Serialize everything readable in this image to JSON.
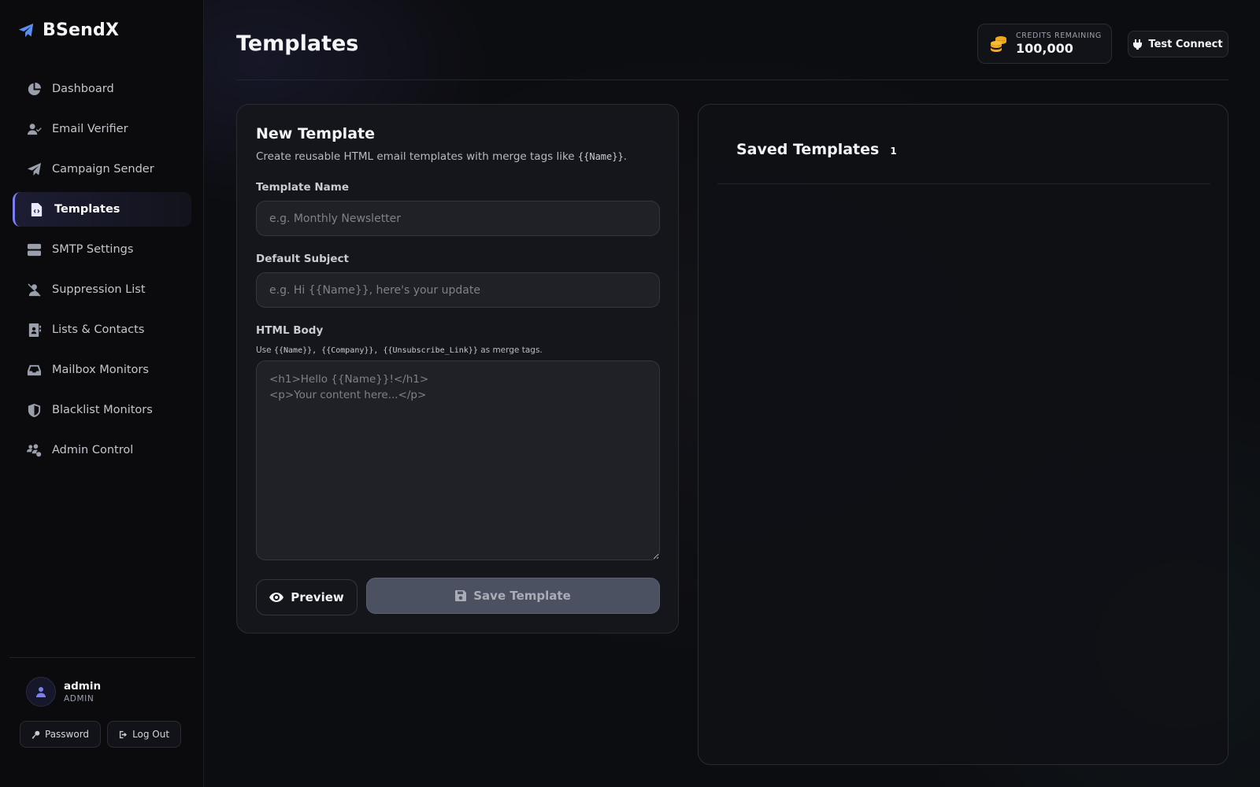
{
  "app": {
    "name": "BSendX"
  },
  "sidebar": {
    "items": [
      {
        "label": "Dashboard",
        "icon": "pie-chart-icon"
      },
      {
        "label": "Email Verifier",
        "icon": "user-check-icon"
      },
      {
        "label": "Campaign Sender",
        "icon": "paper-plane-icon"
      },
      {
        "label": "Templates",
        "icon": "file-code-icon",
        "active": true
      },
      {
        "label": "SMTP Settings",
        "icon": "server-icon"
      },
      {
        "label": "Suppression List",
        "icon": "user-slash-icon"
      },
      {
        "label": "Lists & Contacts",
        "icon": "address-book-icon"
      },
      {
        "label": "Mailbox Monitors",
        "icon": "inbox-icon"
      },
      {
        "label": "Blacklist Monitors",
        "icon": "shield-icon"
      },
      {
        "label": "Admin Control",
        "icon": "users-gear-icon"
      }
    ],
    "user": {
      "name": "admin",
      "role": "ADMIN"
    },
    "password_label": "Password",
    "logout_label": "Log Out"
  },
  "header": {
    "title": "Templates",
    "credits_label": "CREDITS REMAINING",
    "credits_value": "100,000",
    "test_connect_label": "Test Connect"
  },
  "new_template": {
    "title": "New Template",
    "desc_prefix": "Create reusable HTML email templates with merge tags like ",
    "desc_tag": "{{Name}}",
    "desc_suffix": ".",
    "name_label": "Template Name",
    "name_placeholder": "e.g. Monthly Newsletter",
    "name_value": "",
    "subject_label": "Default Subject",
    "subject_placeholder": "e.g. Hi {{Name}}, here's your update",
    "subject_value": "",
    "body_label": "HTML Body",
    "hint_prefix": "Use ",
    "hint_tags": "{{Name}}, {{Company}}, {{Unsubscribe_Link}}",
    "hint_suffix": " as merge tags.",
    "body_placeholder": "<h1>Hello {{Name}}!</h1>\n<p>Your content here...</p>",
    "preview_label": "Preview",
    "save_label": "Save Template"
  },
  "saved_templates": {
    "title": "Saved Templates",
    "count": "1"
  },
  "colors": {
    "accent": "#7b7ff0",
    "credits_coin": "#f0a820",
    "save_button_disabled": "#4b5160"
  }
}
